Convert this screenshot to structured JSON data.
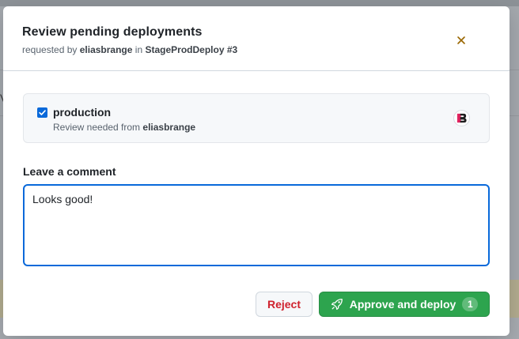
{
  "background": {
    "partial_text": "V"
  },
  "dialog": {
    "title": "Review pending deployments",
    "subtitle": {
      "prefix": "requested by",
      "user": "eliasbrange",
      "middle": "in",
      "workflow_run": "StageProdDeploy #3"
    },
    "close_icon": "x-icon"
  },
  "environment": {
    "checked": true,
    "name": "production",
    "review_prefix": "Review needed from",
    "reviewer": "eliasbrange",
    "avatar_icon": "eb-logo-avatar"
  },
  "comment": {
    "label": "Leave a comment",
    "value": "Looks good!"
  },
  "actions": {
    "reject_label": "Reject",
    "approve_label": "Approve and deploy",
    "approve_icon": "rocket-icon",
    "approve_count": "1"
  },
  "colors": {
    "accent_blue": "#0969da",
    "approve_green": "#2da44e",
    "reject_red": "#cf222e",
    "close_icon": "#9a6700"
  }
}
